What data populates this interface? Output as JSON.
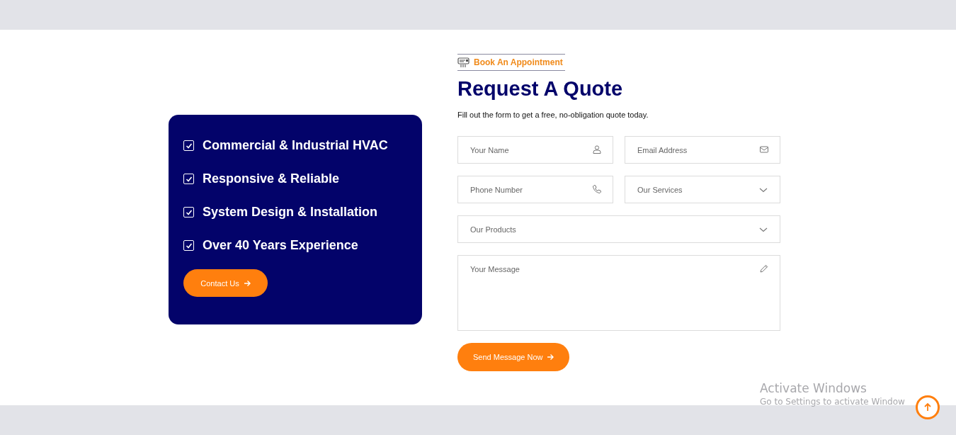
{
  "features": {
    "items": [
      {
        "label": "Commercial & Industrial HVAC",
        "checked": true
      },
      {
        "label": "Responsive & Reliable",
        "checked": true
      },
      {
        "label": "System Design & Installation",
        "checked": true
      },
      {
        "label": "Over 40 Years Experience",
        "checked": true
      }
    ],
    "button": "Contact Us"
  },
  "form": {
    "tagline": "Book An Appointment",
    "title": "Request A Quote",
    "subtitle": "Fill out the form to get a free, no-obligation quote today.",
    "fields": [
      {
        "kind": "name",
        "placeholder": "Your Name"
      },
      {
        "kind": "email",
        "placeholder": "Email Address"
      },
      {
        "kind": "phone",
        "placeholder": "Phone Number"
      },
      {
        "kind": "select",
        "placeholder": "Our Services"
      },
      {
        "kind": "select",
        "placeholder": "Our Products",
        "wide": true
      },
      {
        "kind": "message",
        "placeholder": "Your Message"
      }
    ],
    "submit": "Send Message Now"
  },
  "os_notice": {
    "title": "Activate Windows",
    "text": "Go to Settings to activate Window"
  }
}
